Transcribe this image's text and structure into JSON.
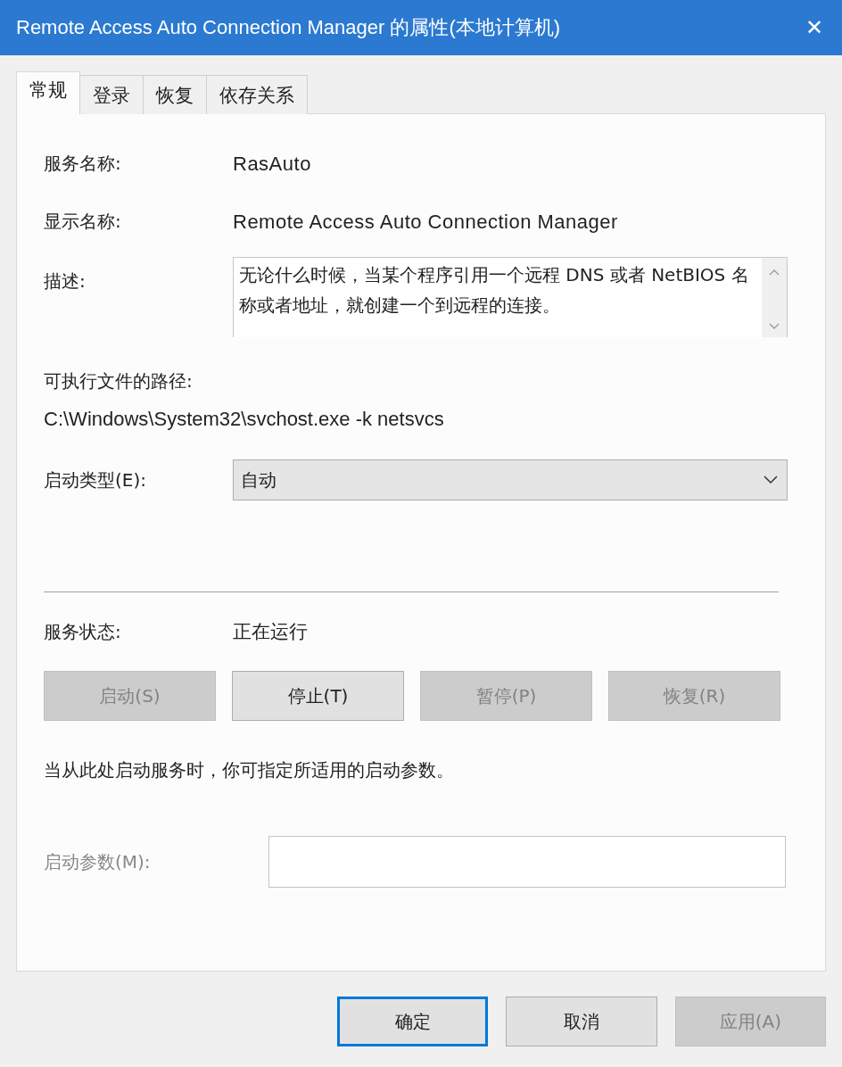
{
  "window": {
    "title": "Remote Access Auto Connection Manager 的属性(本地计算机)",
    "close": "✕"
  },
  "tabs": [
    {
      "label": "常规",
      "selected": true
    },
    {
      "label": "登录",
      "selected": false
    },
    {
      "label": "恢复",
      "selected": false
    },
    {
      "label": "依存关系",
      "selected": false
    }
  ],
  "service_name": {
    "label": "服务名称:",
    "value": "RasAuto"
  },
  "display_name": {
    "label": "显示名称:",
    "value": "Remote Access Auto Connection Manager"
  },
  "description": {
    "label": "描述:",
    "value": "无论什么时候，当某个程序引用一个远程 DNS 或者 NetBIOS 名称或者地址，就创建一个到远程的连接。"
  },
  "executable_path": {
    "label": "可执行文件的路径:",
    "value": "C:\\Windows\\System32\\svchost.exe -k netsvcs"
  },
  "startup_type": {
    "label": "启动类型(E):",
    "value": "自动"
  },
  "service_status": {
    "label": "服务状态:",
    "value": "正在运行"
  },
  "service_buttons": [
    {
      "label": "启动(S)",
      "disabled": true
    },
    {
      "label": "停止(T)",
      "disabled": false
    },
    {
      "label": "暂停(P)",
      "disabled": true
    },
    {
      "label": "恢复(R)",
      "disabled": true
    }
  ],
  "hint": "当从此处启动服务时，你可指定所适用的启动参数。",
  "start_parameters": {
    "label": "启动参数(M):",
    "disabled": true
  },
  "dialog_buttons": [
    {
      "label": "确定",
      "default": true,
      "disabled": false
    },
    {
      "label": "取消",
      "default": false,
      "disabled": false
    },
    {
      "label": "应用(A)",
      "default": false,
      "disabled": true
    }
  ]
}
